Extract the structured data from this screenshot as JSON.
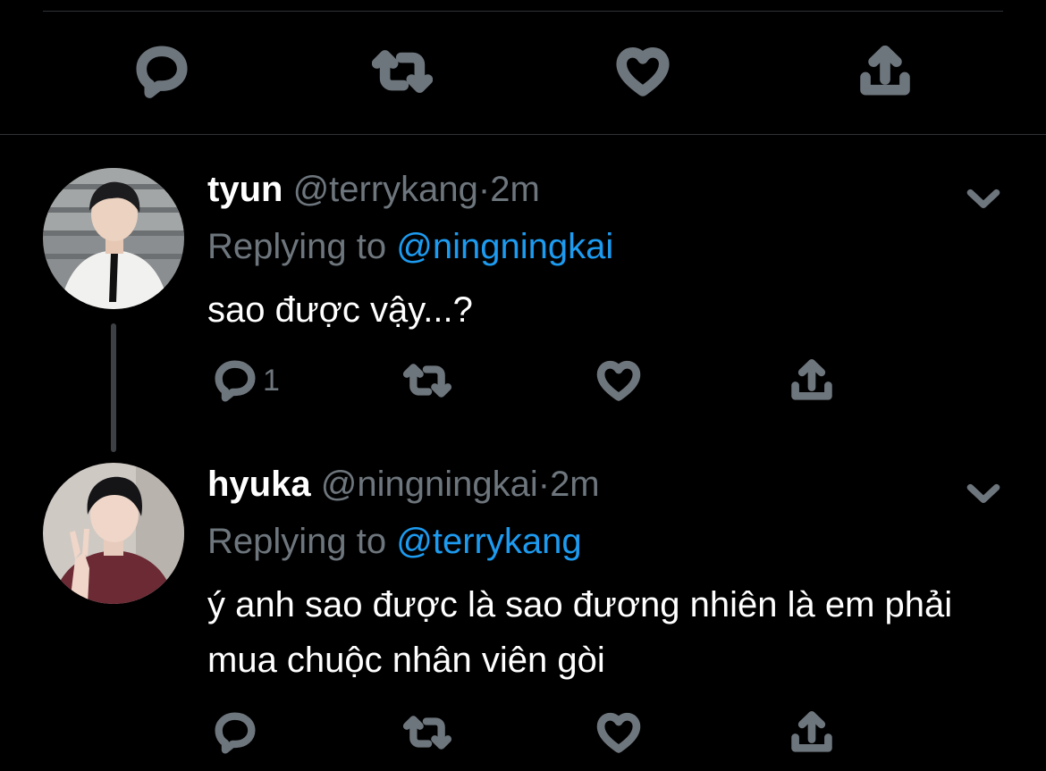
{
  "tweets": [
    {
      "name": "tyun",
      "handle": "@terrykang",
      "separator": "·",
      "time": "2m",
      "replying_prefix": "Replying to",
      "replying_to": "@ningningkai",
      "text": "sao được vậy...?",
      "reply_count": "1",
      "avatar_icon": "person-photo"
    },
    {
      "name": "hyuka",
      "handle": "@ningningkai",
      "separator": "·",
      "time": "2m",
      "replying_prefix": "Replying to",
      "replying_to": "@terrykang",
      "text": "ý anh sao được là sao đương nhiên là em phải mua chuộc nhân viên gòi",
      "reply_count": "",
      "avatar_icon": "person-photo"
    }
  ],
  "icons": {
    "reply": "reply-icon",
    "retweet": "retweet-icon",
    "like": "heart-icon",
    "share": "share-icon",
    "more": "chevron-down-icon"
  },
  "colors": {
    "background": "#000000",
    "muted": "#6e767d",
    "link": "#1d9bf0",
    "divider": "#2f3336"
  }
}
